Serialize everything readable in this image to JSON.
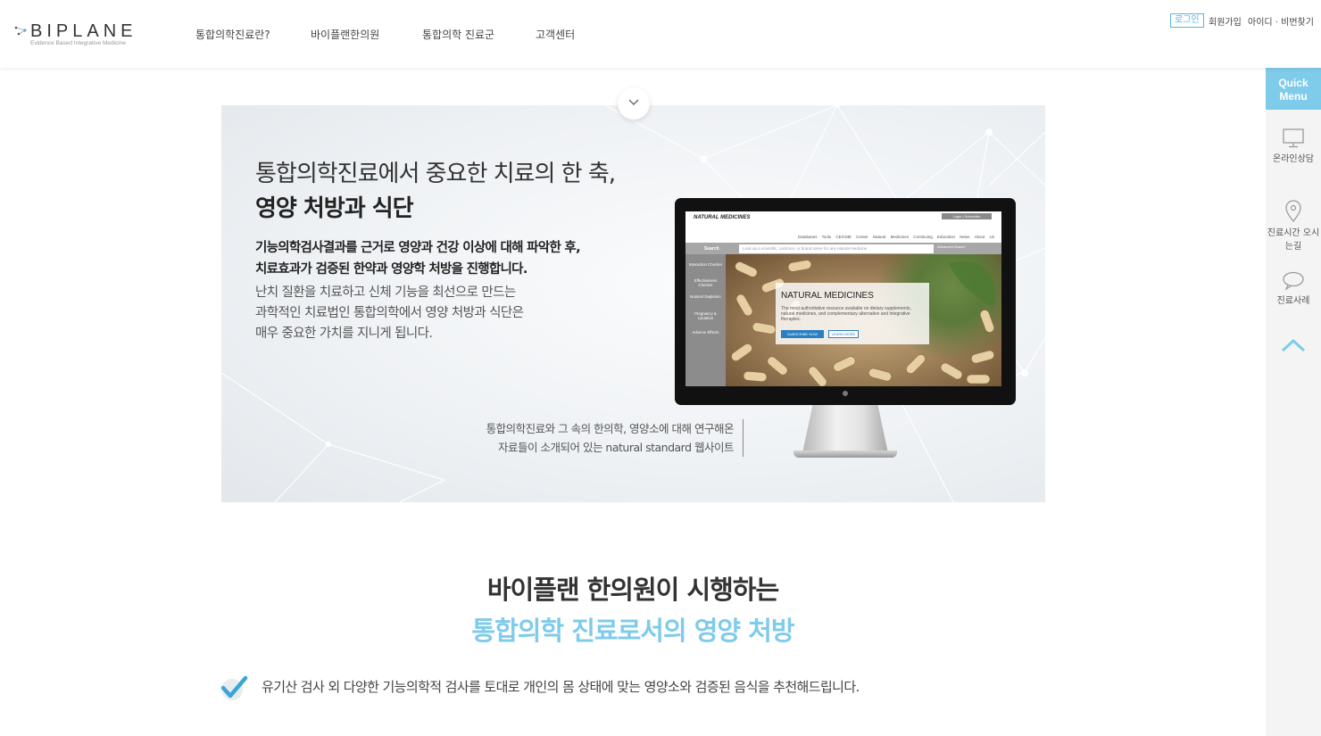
{
  "header": {
    "logo_text": "BIPLANE",
    "logo_subtitle": "Evidence Based Integrative Medicine",
    "nav": [
      "통합의학진료란?",
      "바이플랜한의원",
      "통합의학 진료군",
      "고객센터"
    ],
    "util": {
      "login": "로그인",
      "signup": "회원가입",
      "find_account": "아이디 · 비번찾기"
    }
  },
  "quick_menu": {
    "title": "Quick Menu",
    "items": [
      {
        "label": "온라인상담",
        "icon": "monitor-icon"
      },
      {
        "label": "진료시간 오시는길",
        "icon": "location-pin-icon"
      },
      {
        "label": "진료사례",
        "icon": "speech-bubble-icon"
      }
    ],
    "top_icon": "chevron-up-icon"
  },
  "banner": {
    "title_line1": "통합의학진료에서 중요한 치료의 한 축,",
    "title_line2": "영양 처방과 식단",
    "bold_line1": "기능의학검사결과를 근거로 영양과 건강 이상에 대해 파악한 후,",
    "bold_line2": "치료효과가 검증된 한약과 영양학 처방을 진행합니다.",
    "body_line1": "난치 질환을 치료하고 신체 기능을 최선으로 만드는",
    "body_line2": "과학적인 치료법인 통합의학에서 영양 처방과 식단은",
    "body_line3": "매우 중요한 가치를 지니게 됩니다.",
    "caption_line1": "통합의학진료와 그 속의 한의학, 영양소에 대해 연구해온",
    "caption_line2": "자료들이 소개되어 있는 natural standard 웹사이트",
    "scroll_icon": "chevron-down-icon"
  },
  "website": {
    "logo": "NATURAL MEDICINES",
    "top_buttons": "Login | Subscribe",
    "nav": "Databases Tools CE/CME Center Natural Medicines Continuing Education News About Us",
    "search_label": "Search",
    "search_placeholder": "Look up a scientific, common, or brand name for any natural medicine",
    "advanced": "Advanced Search",
    "side_items": [
      "Interaction Checker",
      "Effectiveness Checker",
      "Nutrient Depletion",
      "Pregnancy & Lactation",
      "Adverse Effects"
    ],
    "card_title": "NATURAL MEDICINES",
    "card_text": "The most authoritative resource available on dietary supplements, natural medicines, and complementary alternative and integrative therapies.",
    "btn_subscribe": "SUBSCRIBE NOW",
    "btn_learn": "LEARN MORE"
  },
  "section": {
    "title_line1": "바이플랜 한의원이 시행하는",
    "title_line2": "통합의학 진료로서의 영양 처방",
    "check_item": "유기산 검사 외 다양한 기능의학적 검사를 토대로 개인의 몸 상태에 맞는 영양소와 검증된 음식을 추천해드립니다."
  },
  "colors": {
    "accent": "#7fcbea",
    "login_border": "#5ab6de",
    "text": "#333333"
  }
}
